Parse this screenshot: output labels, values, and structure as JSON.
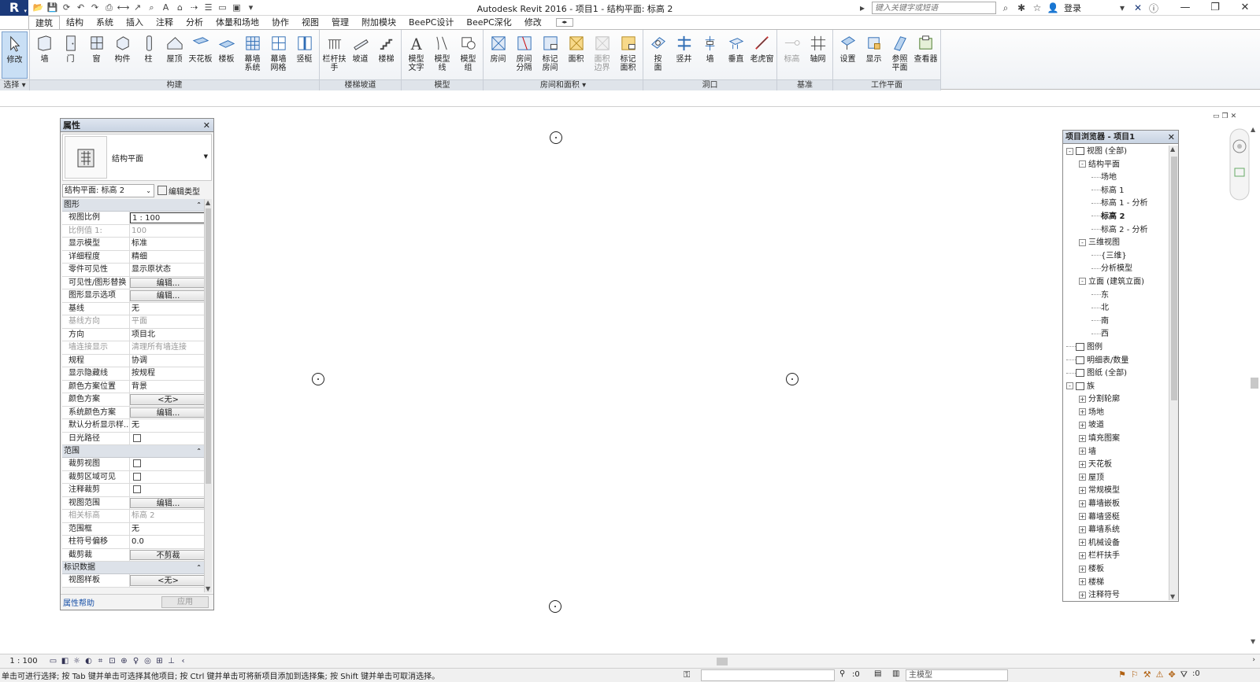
{
  "app": {
    "logo": "R",
    "title": "Autodesk Revit 2016 -    项目1 - 结构平面: 标高 2"
  },
  "search": {
    "placeholder": "键入关键字或短语"
  },
  "account": {
    "login": "登录"
  },
  "ribbon_tabs": [
    "建筑",
    "结构",
    "系统",
    "插入",
    "注释",
    "分析",
    "体量和场地",
    "协作",
    "视图",
    "管理",
    "附加模块",
    "BeePC设计",
    "BeePC深化",
    "修改"
  ],
  "ribbon_panels": [
    {
      "label": "选择 ▾",
      "buttons": [
        {
          "label": "修改",
          "icon": "arrow-cursor-icon",
          "active": true
        }
      ]
    },
    {
      "label": "构建",
      "buttons": [
        {
          "label": "墙",
          "icon": "wall-icon"
        },
        {
          "label": "门",
          "icon": "door-icon"
        },
        {
          "label": "窗",
          "icon": "window-icon"
        },
        {
          "label": "构件",
          "icon": "component-icon"
        },
        {
          "label": "柱",
          "icon": "column-icon"
        },
        {
          "label": "屋顶",
          "icon": "roof-icon"
        },
        {
          "label": "天花板",
          "icon": "ceiling-icon"
        },
        {
          "label": "楼板",
          "icon": "floor-icon"
        },
        {
          "label": "幕墙\n系统",
          "icon": "curtain-system-icon"
        },
        {
          "label": "幕墙\n网格",
          "icon": "curtain-grid-icon"
        },
        {
          "label": "竖梃",
          "icon": "mullion-icon"
        }
      ]
    },
    {
      "label": "楼梯坡道",
      "buttons": [
        {
          "label": "栏杆扶手",
          "icon": "railing-icon"
        },
        {
          "label": "坡道",
          "icon": "ramp-icon"
        },
        {
          "label": "楼梯",
          "icon": "stair-icon"
        }
      ]
    },
    {
      "label": "模型",
      "buttons": [
        {
          "label": "模型\n文字",
          "icon": "model-text-icon"
        },
        {
          "label": "模型\n线",
          "icon": "model-line-icon"
        },
        {
          "label": "模型\n组",
          "icon": "model-group-icon"
        }
      ]
    },
    {
      "label": "房间和面积 ▾",
      "buttons": [
        {
          "label": "房间",
          "icon": "room-icon"
        },
        {
          "label": "房间\n分隔",
          "icon": "room-separator-icon"
        },
        {
          "label": "标记\n房间",
          "icon": "tag-room-icon"
        },
        {
          "label": "面积",
          "icon": "area-icon"
        },
        {
          "label": "面积\n边界",
          "icon": "area-boundary-icon",
          "disabled": true
        },
        {
          "label": "标记\n面积",
          "icon": "tag-area-icon"
        }
      ]
    },
    {
      "label": "洞口",
      "buttons": [
        {
          "label": "按\n面",
          "icon": "by-face-icon"
        },
        {
          "label": "竖井",
          "icon": "shaft-icon"
        },
        {
          "label": "墙",
          "icon": "wall-opening-icon"
        },
        {
          "label": "垂直",
          "icon": "vertical-opening-icon"
        },
        {
          "label": "老虎窗",
          "icon": "dormer-icon"
        }
      ]
    },
    {
      "label": "基准",
      "buttons": [
        {
          "label": "标高",
          "icon": "level-icon",
          "disabled": true
        },
        {
          "label": "轴网",
          "icon": "grid-icon"
        }
      ]
    },
    {
      "label": "工作平面",
      "buttons": [
        {
          "label": "设置",
          "icon": "set-plane-icon"
        },
        {
          "label": "显示",
          "icon": "show-plane-icon"
        },
        {
          "label": "参照\n平面",
          "icon": "ref-plane-icon"
        },
        {
          "label": "查看器",
          "icon": "viewer-icon"
        }
      ]
    }
  ],
  "properties": {
    "title": "属性",
    "type_name": "结构平面",
    "instance": "结构平面: 标高 2",
    "edit_type": "编辑类型",
    "sections": [
      {
        "name": "图形",
        "rows": [
          {
            "k": "视图比例",
            "v": "1 : 100",
            "kind": "field"
          },
          {
            "k": "比例值 1:",
            "v": "100",
            "dim": true
          },
          {
            "k": "显示模型",
            "v": "标准"
          },
          {
            "k": "详细程度",
            "v": "精细"
          },
          {
            "k": "零件可见性",
            "v": "显示原状态"
          },
          {
            "k": "可见性/图形替换",
            "v": "编辑...",
            "kind": "btn"
          },
          {
            "k": "图形显示选项",
            "v": "编辑...",
            "kind": "btn"
          },
          {
            "k": "基线",
            "v": "无"
          },
          {
            "k": "基线方向",
            "v": "平面",
            "dim": true
          },
          {
            "k": "方向",
            "v": "项目北"
          },
          {
            "k": "墙连接显示",
            "v": "清理所有墙连接",
            "dim": true
          },
          {
            "k": "规程",
            "v": "协调"
          },
          {
            "k": "显示隐藏线",
            "v": "按规程"
          },
          {
            "k": "颜色方案位置",
            "v": "背景"
          },
          {
            "k": "颜色方案",
            "v": "<无>",
            "kind": "btn"
          },
          {
            "k": "系统颜色方案",
            "v": "编辑...",
            "kind": "btn"
          },
          {
            "k": "默认分析显示样...",
            "v": "无"
          },
          {
            "k": "日光路径",
            "v": "",
            "kind": "check"
          }
        ]
      },
      {
        "name": "范围",
        "rows": [
          {
            "k": "裁剪视图",
            "v": "",
            "kind": "check"
          },
          {
            "k": "裁剪区域可见",
            "v": "",
            "kind": "check"
          },
          {
            "k": "注释裁剪",
            "v": "",
            "kind": "check"
          },
          {
            "k": "视图范围",
            "v": "编辑...",
            "kind": "btn"
          },
          {
            "k": "相关标高",
            "v": "标高 2",
            "dim": true
          },
          {
            "k": "范围框",
            "v": "无"
          },
          {
            "k": "柱符号偏移",
            "v": "0.0"
          },
          {
            "k": "截剪裁",
            "v": "不剪裁",
            "kind": "btn"
          }
        ]
      },
      {
        "name": "标识数据",
        "rows": [
          {
            "k": "视图样板",
            "v": "<无>",
            "kind": "btn"
          }
        ]
      }
    ],
    "help": "属性帮助",
    "apply": "应用"
  },
  "browser": {
    "title": "项目浏览器 - 项目1",
    "nodes": [
      {
        "label": "视图 (全部)",
        "depth": 0,
        "tog": "-",
        "icon": true
      },
      {
        "label": "结构平面",
        "depth": 1,
        "tog": "-"
      },
      {
        "label": "场地",
        "depth": 2
      },
      {
        "label": "标高 1",
        "depth": 2
      },
      {
        "label": "标高 1 - 分析",
        "depth": 2
      },
      {
        "label": "标高 2",
        "depth": 2,
        "bold": true
      },
      {
        "label": "标高 2 - 分析",
        "depth": 2
      },
      {
        "label": "三维视图",
        "depth": 1,
        "tog": "-"
      },
      {
        "label": "{三维}",
        "depth": 2
      },
      {
        "label": "分析模型",
        "depth": 2
      },
      {
        "label": "立面 (建筑立面)",
        "depth": 1,
        "tog": "-"
      },
      {
        "label": "东",
        "depth": 2
      },
      {
        "label": "北",
        "depth": 2
      },
      {
        "label": "南",
        "depth": 2
      },
      {
        "label": "西",
        "depth": 2
      },
      {
        "label": "图例",
        "depth": 0,
        "icon": true
      },
      {
        "label": "明细表/数量",
        "depth": 0,
        "icon": true
      },
      {
        "label": "图纸 (全部)",
        "depth": 0,
        "icon": true
      },
      {
        "label": "族",
        "depth": 0,
        "tog": "-",
        "icon": true
      },
      {
        "label": "分割轮廓",
        "depth": 1,
        "tog": "+"
      },
      {
        "label": "场地",
        "depth": 1,
        "tog": "+"
      },
      {
        "label": "坡道",
        "depth": 1,
        "tog": "+"
      },
      {
        "label": "填充图案",
        "depth": 1,
        "tog": "+"
      },
      {
        "label": "墙",
        "depth": 1,
        "tog": "+"
      },
      {
        "label": "天花板",
        "depth": 1,
        "tog": "+"
      },
      {
        "label": "屋顶",
        "depth": 1,
        "tog": "+"
      },
      {
        "label": "常规模型",
        "depth": 1,
        "tog": "+"
      },
      {
        "label": "幕墙嵌板",
        "depth": 1,
        "tog": "+"
      },
      {
        "label": "幕墙竖梃",
        "depth": 1,
        "tog": "+"
      },
      {
        "label": "幕墙系统",
        "depth": 1,
        "tog": "+"
      },
      {
        "label": "机械设备",
        "depth": 1,
        "tog": "+"
      },
      {
        "label": "栏杆扶手",
        "depth": 1,
        "tog": "+"
      },
      {
        "label": "楼板",
        "depth": 1,
        "tog": "+"
      },
      {
        "label": "楼梯",
        "depth": 1,
        "tog": "+"
      },
      {
        "label": "注释符号",
        "depth": 1,
        "tog": "+"
      }
    ]
  },
  "viewbar": {
    "scale": "1 : 100"
  },
  "status": {
    "text": "单击可进行选择; 按 Tab 键并单击可选择其他项目; 按 Ctrl 键并单击可将新项目添加到选择集; 按 Shift 键并单击可取消选择。",
    "selected_count": ":0",
    "model": "主模型",
    "filter_count": ":0"
  }
}
